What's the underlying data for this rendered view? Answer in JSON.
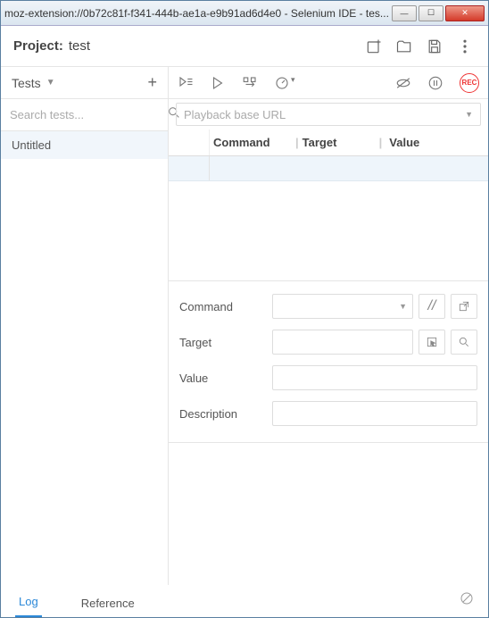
{
  "titlebar": "moz-extension://0b72c81f-f341-444b-ae1a-e9b91ad6d4e0 - Selenium IDE - tes...",
  "header": {
    "project_label": "Project:",
    "project_name": "test"
  },
  "sidebar": {
    "tests_label": "Tests",
    "search_placeholder": "Search tests...",
    "items": [
      {
        "name": "Untitled"
      }
    ]
  },
  "urlbar": {
    "placeholder": "Playback base URL"
  },
  "columns": {
    "command": "Command",
    "target": "Target",
    "value": "Value"
  },
  "form": {
    "command": "Command",
    "target": "Target",
    "value": "Value",
    "description": "Description"
  },
  "bottom_tabs": {
    "log": "Log",
    "reference": "Reference"
  },
  "rec_label": "REC",
  "slashes": "//"
}
